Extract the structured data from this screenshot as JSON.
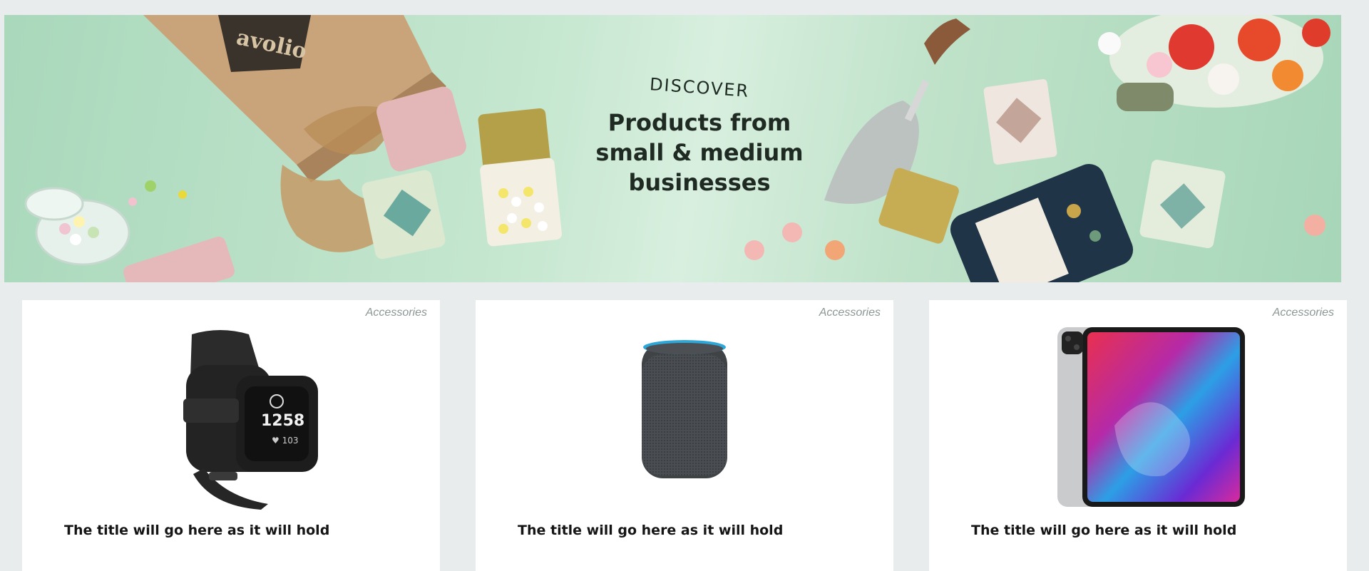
{
  "hero": {
    "kicker": "DISCOVER",
    "headline": "Products from\nsmall & medium\nbusinesses",
    "box_brand": "avolio"
  },
  "cards": [
    {
      "category": "Accessories",
      "title": "The title will go here as it will hold",
      "product_image": "fitness-tracker-band",
      "tracker_display": "1258"
    },
    {
      "category": "Accessories",
      "title": "The title will go here as it will hold",
      "product_image": "smart-speaker"
    },
    {
      "category": "Accessories",
      "title": "The title will go here as it will hold",
      "product_image": "tablet"
    }
  ],
  "colors": {
    "page_bg": "#e9ecec",
    "hero_bg": "#c6e7d0",
    "card_bg": "#ffffff",
    "category_text": "#8d9696",
    "title_text": "#151515"
  }
}
